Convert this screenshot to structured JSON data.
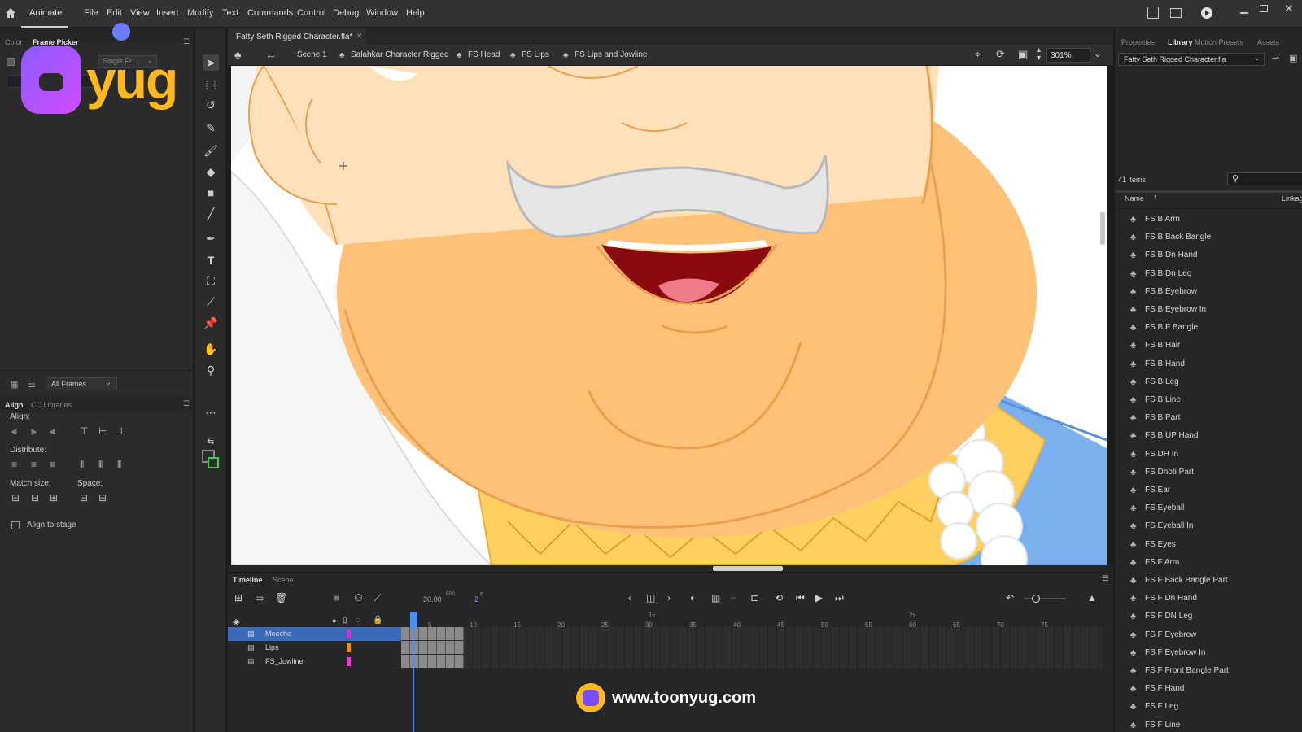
{
  "menubar": {
    "app_name": "Animate",
    "items": [
      "File",
      "Edit",
      "View",
      "Insert",
      "Modify",
      "Text",
      "Commands",
      "Control",
      "Debug",
      "Window",
      "Help"
    ]
  },
  "left_panel": {
    "tabs": [
      "Color",
      "Frame Picker"
    ],
    "frame_picker_dropdown": "Single Fr...",
    "frames_dropdown": "All Frames",
    "align_tabs": [
      "Align",
      "CC Libraries"
    ],
    "align_label": "Align:",
    "distribute_label": "Distribute:",
    "match_size_label": "Match size:",
    "space_label": "Space:",
    "align_to_stage_label": "Align to stage"
  },
  "document": {
    "tab_title": "Fatty Seth Rigged Character.fla*",
    "breadcrumbs": [
      "Scene 1",
      "Salahkar Character Rigged",
      "FS Head",
      "FS Lips",
      "FS Lips and Jowline"
    ],
    "zoom": "301%"
  },
  "timeline": {
    "tabs": [
      "Timeline",
      "Scene"
    ],
    "fps": "30.00",
    "fps_unit": "FPS",
    "current_frame": "2",
    "frame_unit": "F",
    "layers": [
      {
        "name": "Mooche",
        "color": "#c23bd4",
        "selected": true
      },
      {
        "name": "Lips",
        "color": "#f08a12",
        "selected": false
      },
      {
        "name": "FS_Jowline",
        "color": "#e040d8",
        "selected": false
      }
    ],
    "frame_numbers": [
      "5",
      "10",
      "15",
      "20",
      "25",
      "30",
      "35",
      "40",
      "45",
      "50",
      "55",
      "60",
      "65",
      "70",
      "75"
    ],
    "second_markers": [
      "1s",
      "2s"
    ]
  },
  "right_panel": {
    "tabs": [
      "Properties",
      "Library",
      "Motion Presets",
      "Assets"
    ],
    "library_file": "Fatty Seth Rigged Character.fla",
    "item_count": "41 items",
    "col_name": "Name",
    "col_linkage": "Linkage",
    "items": [
      "FS B Arm",
      "FS B Back Bangle",
      "FS B Dn Hand",
      "FS B Dn Leg",
      "FS B Eyebrow",
      "FS B Eyebrow In",
      "FS B F Bangle",
      "FS B Hair",
      "FS B Hand",
      "FS B Leg",
      "FS B Line",
      "FS B Part",
      "FS B UP Hand",
      "FS DH In",
      "FS Dhoti Part",
      "FS Ear",
      "FS Eyeball",
      "FS Eyeball In",
      "FS Eyes",
      "FS F Arm",
      "FS F Back Bangle Part",
      "FS F Dn Hand",
      "FS F DN Leg",
      "FS F Eyebrow",
      "FS F Eyebrow In",
      "FS F Front Bangle Part",
      "FS F Hand",
      "FS F Leg",
      "FS F Line"
    ]
  },
  "overlay": {
    "logo_text": "yug",
    "website": "www.toonyug.com"
  },
  "colors": {
    "skin_light": "#ffe0b8",
    "skin_main": "#ffc078",
    "outline": "#e8a050",
    "mustache": "#e6e6e6",
    "mouth": "#8a0a10",
    "tongue": "#f07a8a",
    "shirt_blue": "#7ab0f0",
    "gold": "#ffd060",
    "playhead": "#4a8ef0"
  }
}
